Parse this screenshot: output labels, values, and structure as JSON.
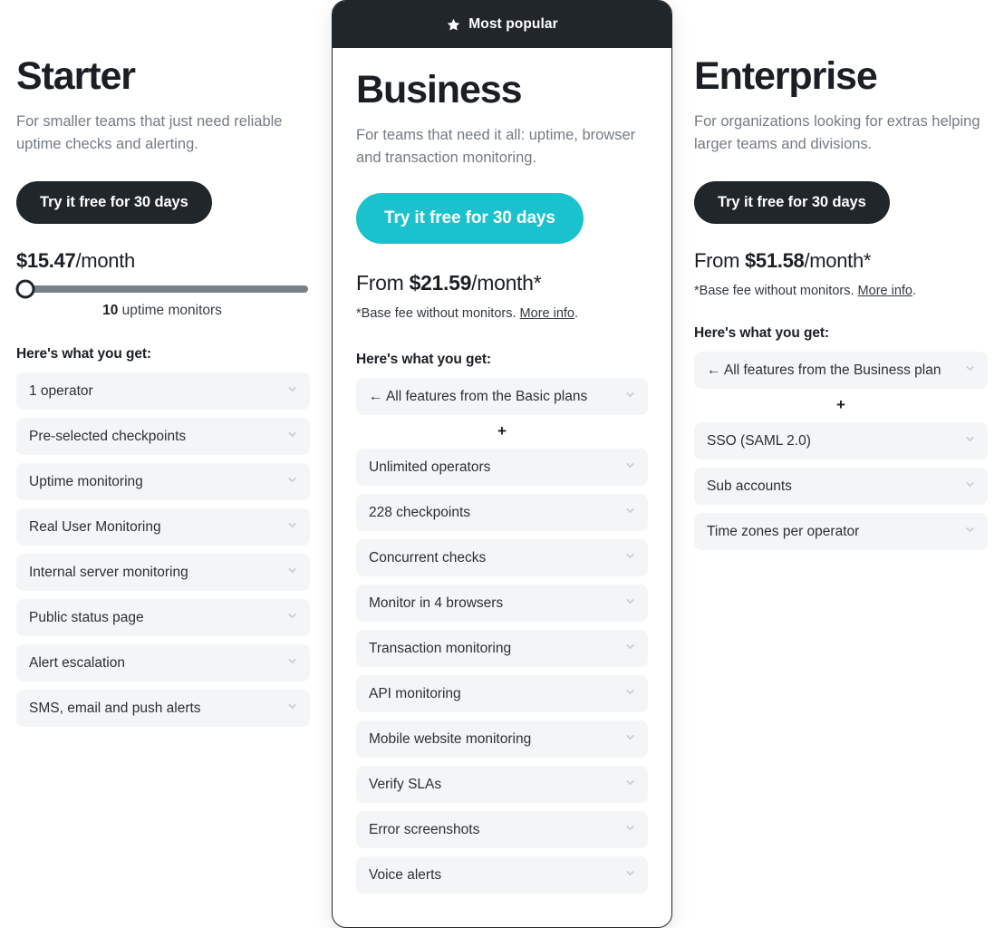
{
  "plans": [
    {
      "id": "starter",
      "name": "Starter",
      "description": "For smaller teams that just need reliable uptime checks and alerting.",
      "cta_label": "Try it free for 30 days",
      "price_prefix": "",
      "price_amount": "$15.47",
      "price_period": "/month",
      "price_note": "",
      "price_note_link": "",
      "price_note_suffix": "",
      "slider": {
        "count": "10",
        "unit": "uptime monitors",
        "position_percent": 3
      },
      "features_title": "Here's what you get:",
      "features": [
        "1 operator",
        "Pre-selected checkpoints",
        "Uptime monitoring",
        "Real User Monitoring",
        "Internal server monitoring",
        "Public status page",
        "Alert escalation",
        "SMS, email and push alerts"
      ],
      "inherit_feature": "",
      "plus_separator": ""
    },
    {
      "id": "business",
      "name": "Business",
      "description": "For teams that need it all: uptime, browser and transaction monitoring.",
      "badge_label": "Most popular",
      "badge_icon": "star-icon",
      "cta_label": "Try it free for 30 days",
      "price_prefix": "From",
      "price_amount": "$21.59",
      "price_period": "/month*",
      "price_note": "*Base fee without monitors.",
      "price_note_link": "More info",
      "price_note_suffix": ".",
      "features_title": "Here's what you get:",
      "inherit_feature": "← All features from the Basic plans",
      "plus_separator": "+",
      "features": [
        "Unlimited operators",
        "228 checkpoints",
        "Concurrent checks",
        "Monitor in 4 browsers",
        "Transaction monitoring",
        "API monitoring",
        "Mobile website monitoring",
        "Verify SLAs",
        "Error screenshots",
        "Voice alerts"
      ]
    },
    {
      "id": "enterprise",
      "name": "Enterprise",
      "description": "For organizations looking for extras helping larger teams and divisions.",
      "cta_label": "Try it free for 30 days",
      "price_prefix": "From",
      "price_amount": "$51.58",
      "price_period": "/month*",
      "price_note": "*Base fee without monitors.",
      "price_note_link": "More info",
      "price_note_suffix": ".",
      "features_title": "Here's what you get:",
      "inherit_feature": "← All features from the Business plan",
      "plus_separator": "+",
      "features": [
        "SSO (SAML 2.0)",
        "Sub accounts",
        "Time zones per operator"
      ]
    }
  ],
  "colors": {
    "dark": "#21262b",
    "accent_teal": "#19c2cd",
    "feature_bg": "#f4f5f6",
    "muted_text": "#757c84",
    "slider_track": "#7b8287"
  },
  "icons": {
    "chevron_down": "chevron-down-icon",
    "star": "star-icon"
  }
}
